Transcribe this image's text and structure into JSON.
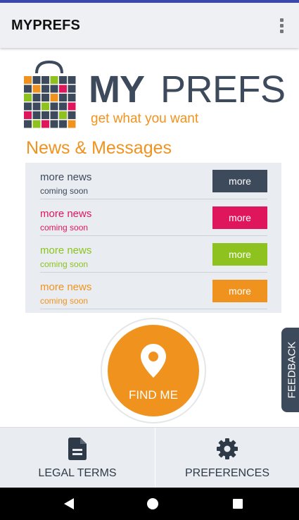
{
  "app_bar": {
    "title": "MYPREFS",
    "overflow_icon": "more-vert-icon"
  },
  "logo": {
    "brand_bold": "MY",
    "brand_regular": "PREFS",
    "tagline": "get what you want"
  },
  "colors": {
    "dark": "#3d4a5c",
    "pink": "#e0165c",
    "green": "#8dc21f",
    "orange": "#f0931e"
  },
  "news": {
    "heading": "News & Messages",
    "items": [
      {
        "title": "more news",
        "subtitle": "coming soon",
        "button": "more",
        "color": "#3d4a5c"
      },
      {
        "title": "more news",
        "subtitle": "coming soon",
        "button": "more",
        "color": "#e0165c"
      },
      {
        "title": "more news",
        "subtitle": "coming soon",
        "button": "more",
        "color": "#8dc21f"
      },
      {
        "title": "more news",
        "subtitle": "coming soon",
        "button": "more",
        "color": "#f0931e"
      }
    ]
  },
  "find_me": {
    "label": "FIND ME",
    "icon": "location-pin-icon"
  },
  "feedback": {
    "label": "FEEDBACK"
  },
  "bottom_nav": {
    "legal": {
      "label": "LEGAL TERMS",
      "icon": "document-icon"
    },
    "preferences": {
      "label": "PREFERENCES",
      "icon": "gear-icon"
    }
  },
  "system_nav": {
    "back_icon": "back-triangle-icon",
    "home_icon": "home-circle-icon",
    "recents_icon": "recents-square-icon"
  }
}
